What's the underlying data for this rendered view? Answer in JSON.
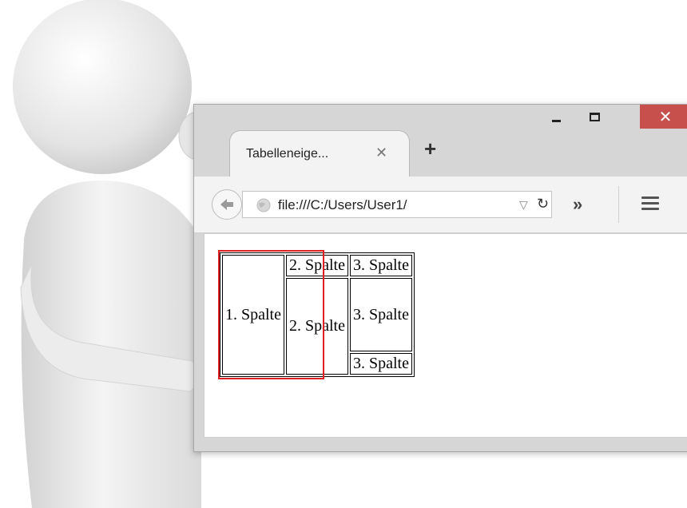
{
  "window": {
    "minimize_label": "minimize",
    "maximize_label": "maximize",
    "close_glyph": "✕"
  },
  "tab": {
    "title": "Tabelleneige...",
    "close_glyph": "✕",
    "new_tab_glyph": "+"
  },
  "navbar": {
    "url": "file:///C:/Users/User1/",
    "overflow_glyph": "»",
    "icons": [
      "back-arrow-icon",
      "globe-icon",
      "dropdown-icon",
      "reload-icon",
      "menu-icon"
    ]
  },
  "table": {
    "rows": [
      [
        "1. Spalte",
        "2. Spalte",
        "3. Spalte"
      ],
      [
        "3. Spalte"
      ],
      [
        "2. Spalte",
        "3. Spalte"
      ]
    ]
  },
  "colors": {
    "close_button": "#c7504c",
    "highlight": "#e02020"
  }
}
